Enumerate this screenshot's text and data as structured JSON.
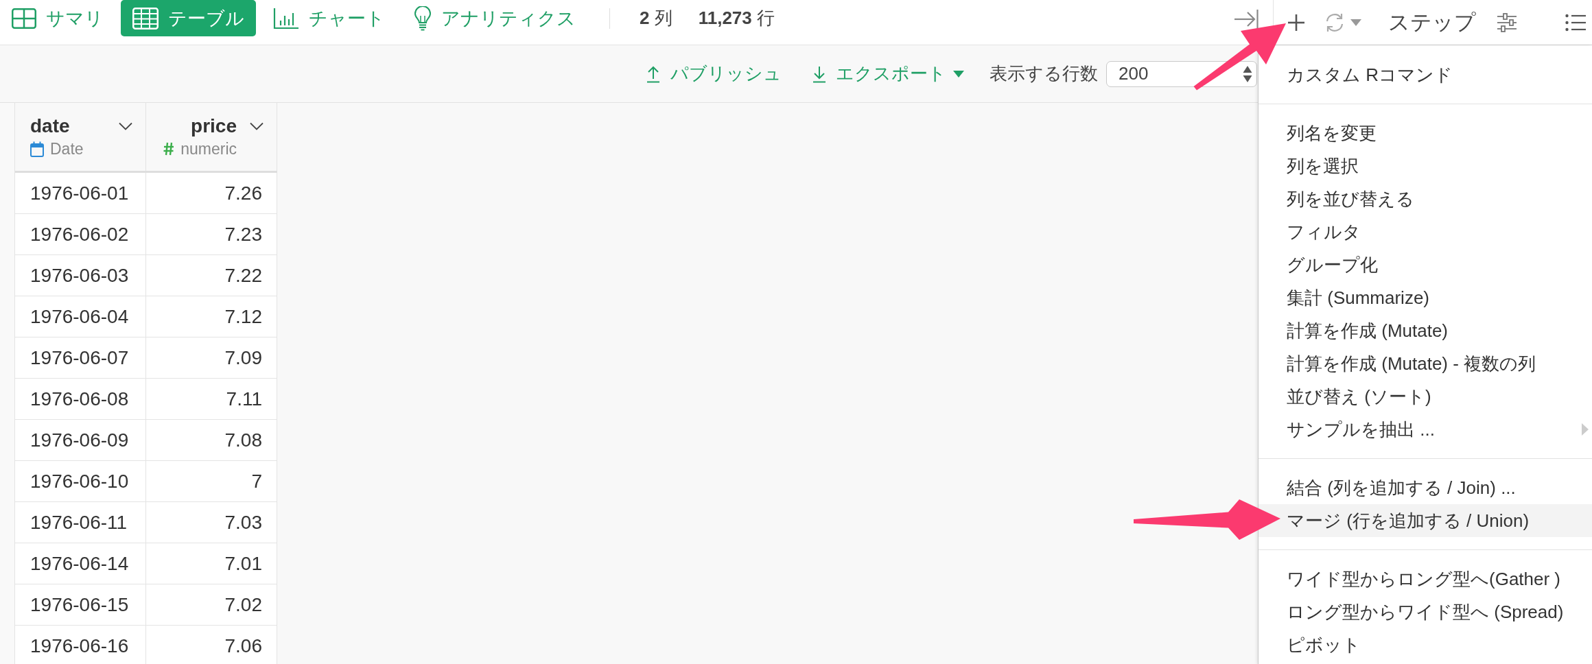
{
  "view_tabs": [
    {
      "kind": "summary",
      "label": "サマリ",
      "selected": false
    },
    {
      "kind": "table",
      "label": "テーブル",
      "selected": true
    },
    {
      "kind": "chart",
      "label": "チャート",
      "selected": false
    },
    {
      "kind": "analytics",
      "label": "アナリティクス",
      "selected": false
    }
  ],
  "counts": [
    "**2** 列",
    "**11,273** 行"
  ],
  "toolbar": {
    "publish": "パブリッシュ",
    "export": "エクスポート",
    "rows_label": "表示する行数",
    "rows_value": "200"
  },
  "table": {
    "columns": [
      {
        "kind": "date",
        "name": "date",
        "type": "Date"
      },
      {
        "kind": "numeric",
        "name": "price",
        "type": "numeric"
      }
    ],
    "rows": [
      [
        "1976-06-01",
        "7.26"
      ],
      [
        "1976-06-02",
        "7.23"
      ],
      [
        "1976-06-03",
        "7.22"
      ],
      [
        "1976-06-04",
        "7.12"
      ],
      [
        "1976-06-07",
        "7.09"
      ],
      [
        "1976-06-08",
        "7.11"
      ],
      [
        "1976-06-09",
        "7.08"
      ],
      [
        "1976-06-10",
        "7"
      ],
      [
        "1976-06-11",
        "7.03"
      ],
      [
        "1976-06-14",
        "7.01"
      ],
      [
        "1976-06-15",
        "7.02"
      ],
      [
        "1976-06-16",
        "7.06"
      ]
    ]
  },
  "steps_panel": {
    "title": "ステップ"
  },
  "menu": {
    "sections": [
      {
        "items": [
          {
            "label": "カスタム Rコマンド",
            "selected": false,
            "submenu": false
          }
        ]
      },
      {
        "items": [
          {
            "label": "列名を変更",
            "selected": false,
            "submenu": false
          },
          {
            "label": "列を選択",
            "selected": false,
            "submenu": false
          },
          {
            "label": "列を並び替える",
            "selected": false,
            "submenu": false
          },
          {
            "label": "フィルタ",
            "selected": false,
            "submenu": false
          },
          {
            "label": "グループ化",
            "selected": false,
            "submenu": false
          },
          {
            "label": "集計 (Summarize)",
            "selected": false,
            "submenu": false
          },
          {
            "label": "計算を作成 (Mutate)",
            "selected": false,
            "submenu": false
          },
          {
            "label": "計算を作成 (Mutate) - 複数の列",
            "selected": false,
            "submenu": false
          },
          {
            "label": "並び替え (ソート)",
            "selected": false,
            "submenu": false
          },
          {
            "label": "サンプルを抽出 ...",
            "selected": false,
            "submenu": true
          }
        ]
      },
      {
        "items": [
          {
            "label": "結合 (列を追加する / Join) ...",
            "selected": false,
            "submenu": false
          },
          {
            "label": "マージ (行を追加する / Union)",
            "selected": true,
            "submenu": false
          }
        ]
      },
      {
        "items": [
          {
            "label": "ワイド型からロング型へ(Gather )",
            "selected": false,
            "submenu": false
          },
          {
            "label": "ロング型からワイド型へ (Spread)",
            "selected": false,
            "submenu": false
          },
          {
            "label": "ピボット",
            "selected": false,
            "submenu": false
          }
        ]
      }
    ]
  }
}
